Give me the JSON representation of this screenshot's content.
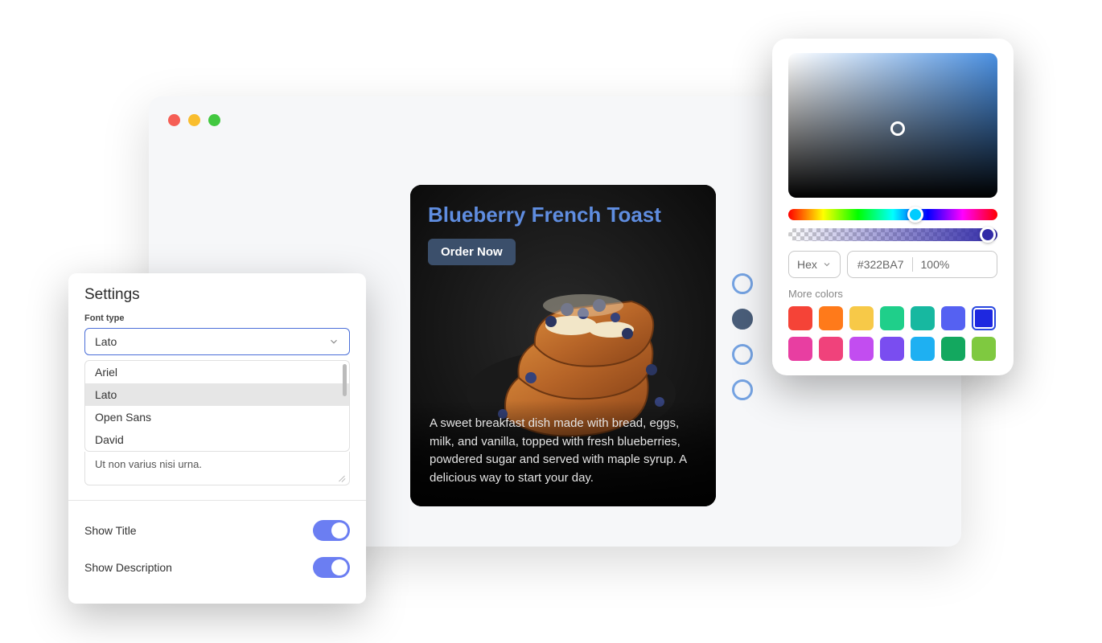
{
  "preview": {
    "title": "Blueberry French Toast",
    "button_label": "Order Now",
    "description": "A sweet breakfast dish made with bread, eggs, milk, and vanilla, topped with fresh blueberries, powdered sugar and served with maple syrup. A delicious way to start your day."
  },
  "side_dots": [
    {
      "selected": false
    },
    {
      "selected": true
    },
    {
      "selected": false
    },
    {
      "selected": false
    }
  ],
  "settings": {
    "title": "Settings",
    "font_type_label": "Font type",
    "font_selected": "Lato",
    "font_options": [
      "Ariel",
      "Lato",
      "Open Sans",
      "David"
    ],
    "textarea_value": "Ut non varius nisi urna.",
    "rows": [
      {
        "label": "Show Title",
        "on": true
      },
      {
        "label": "Show Description",
        "on": true
      }
    ]
  },
  "color_picker": {
    "format": "Hex",
    "hex": "#322BA7",
    "alpha": "100%",
    "more_label": "More colors",
    "swatches_row1": [
      "#f54337",
      "#ff7a1a",
      "#f7c948",
      "#1fcf8a",
      "#17b8a0",
      "#5561f2",
      "#1e28e0"
    ],
    "swatches_row2": [
      "#e83ea1",
      "#f0427b",
      "#c24df0",
      "#7a4df0",
      "#1eb0f2",
      "#13a85f",
      "#7fc940"
    ],
    "selected_index": 6
  }
}
